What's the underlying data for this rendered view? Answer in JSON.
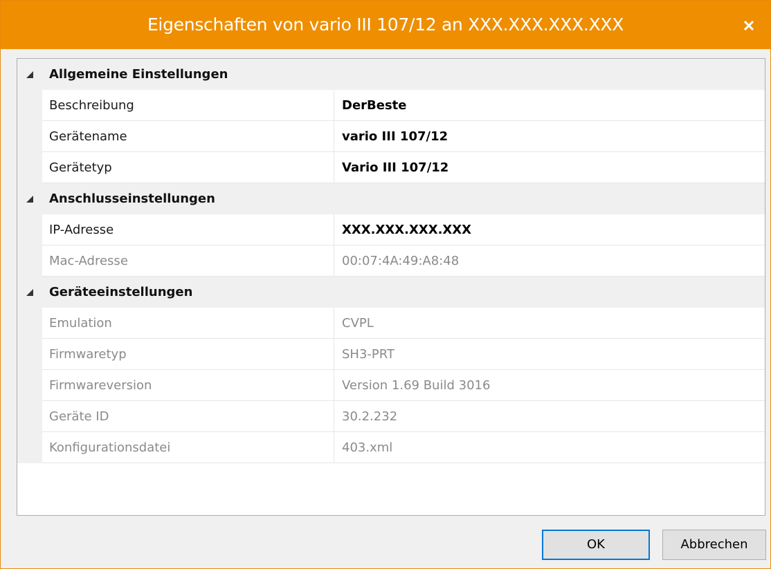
{
  "window": {
    "title": "Eigenschaften von vario III 107/12 an XXX.XXX.XXX.XXX",
    "close_icon": "close-icon",
    "accent_color": "#ee8e00"
  },
  "categories": [
    {
      "label": "Allgemeine Einstellungen",
      "expanded": true,
      "rows": [
        {
          "name": "Beschreibung",
          "value": "DerBeste"
        },
        {
          "name": "Gerätename",
          "value": "vario III 107/12"
        },
        {
          "name": "Gerätetyp",
          "value": "Vario III 107/12"
        }
      ]
    },
    {
      "label": "Anschlusseinstellungen",
      "expanded": true,
      "rows": [
        {
          "name": "IP-Adresse",
          "value": "XXX.XXX.XXX.XXX"
        },
        {
          "name": "Mac-Adresse",
          "value": "00:07:4A:49:A8:48"
        }
      ]
    },
    {
      "label": "Geräteeinstellungen",
      "expanded": true,
      "rows": [
        {
          "name": "Emulation",
          "value": "CVPL"
        },
        {
          "name": "Firmwaretyp",
          "value": "SH3-PRT"
        },
        {
          "name": "Firmwareversion",
          "value": "Version 1.69 Build 3016"
        },
        {
          "name": "Geräte ID",
          "value": "30.2.232"
        },
        {
          "name": "Konfigurationsdatei",
          "value": "403.xml"
        }
      ]
    }
  ],
  "buttons": {
    "ok_label": "OK",
    "cancel_label": "Abbrechen"
  }
}
